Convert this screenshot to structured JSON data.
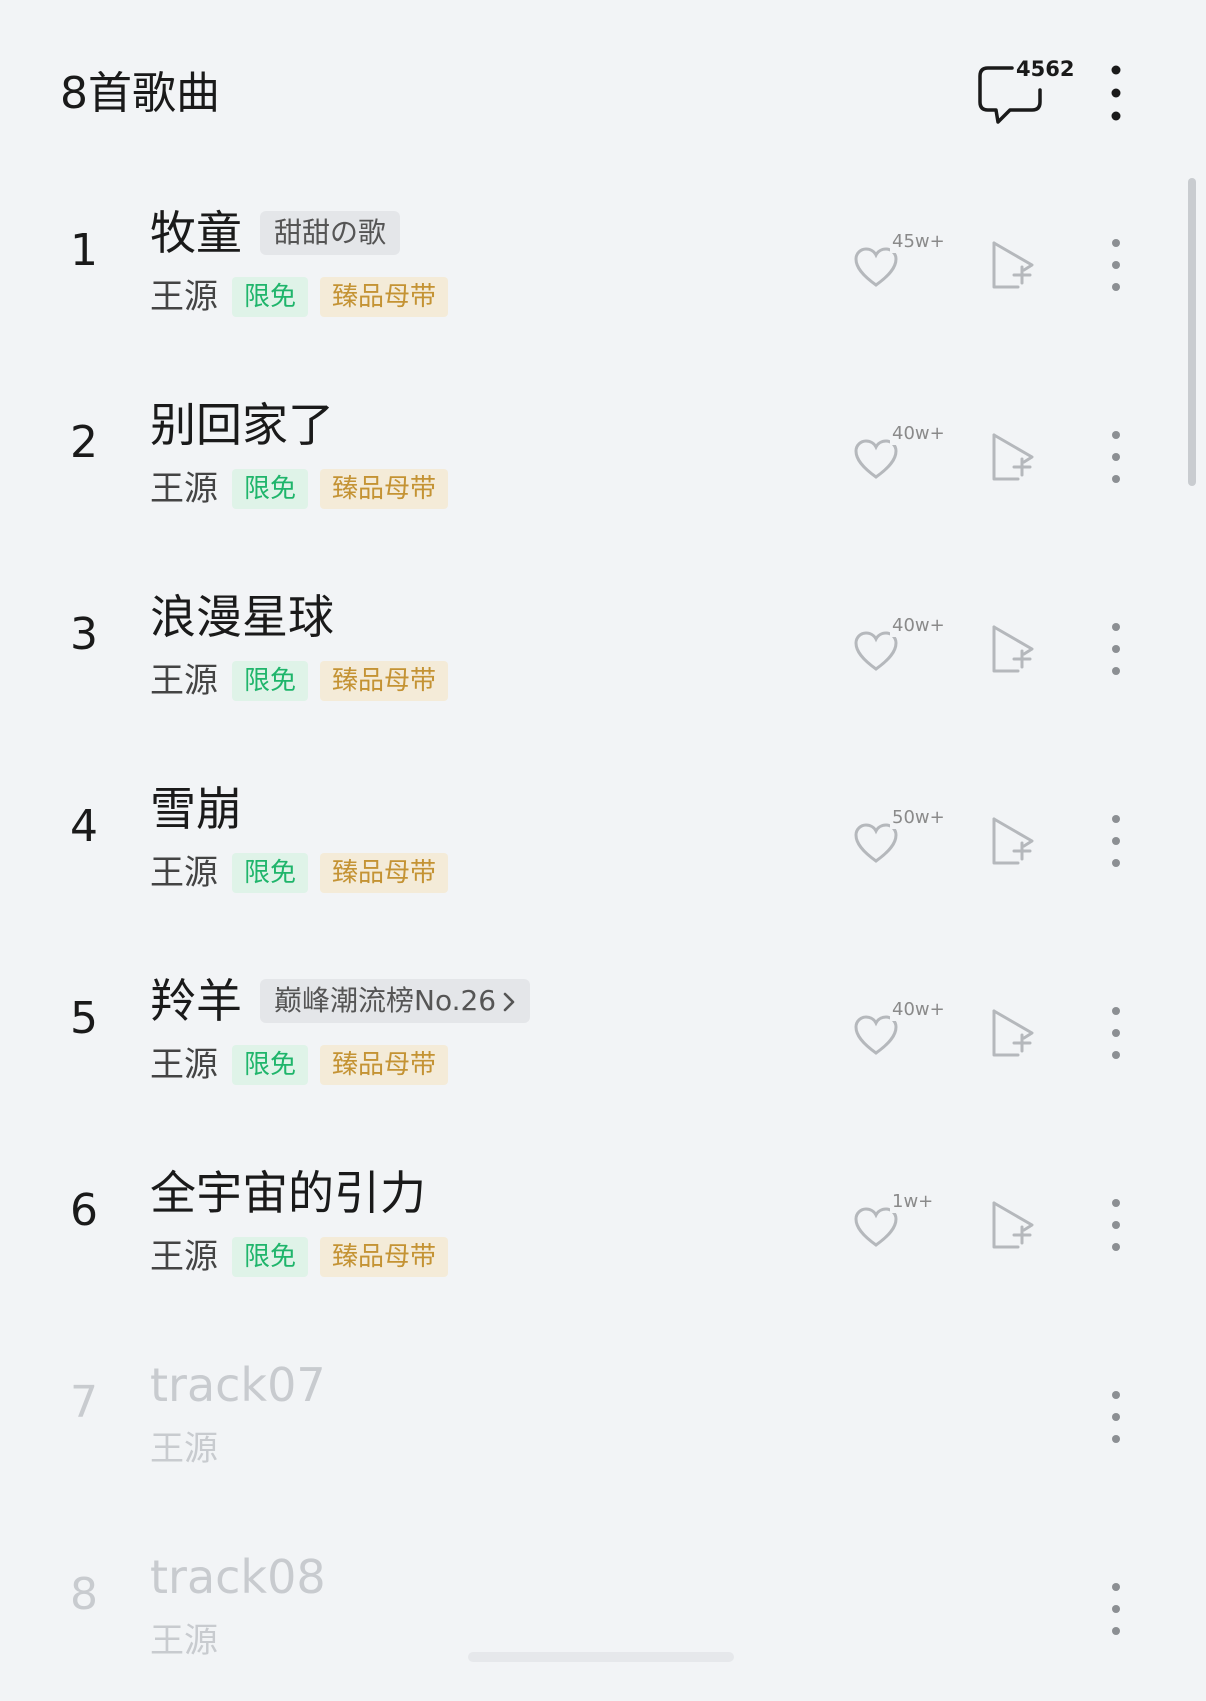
{
  "header": {
    "title": "8首歌曲",
    "comment_count": "4562"
  },
  "songs": [
    {
      "index": "1",
      "title": "牧童",
      "tag": "甜甜の歌",
      "artist": "王源",
      "badge_free": "限免",
      "badge_master": "臻品母带",
      "likes": "45w+"
    },
    {
      "index": "2",
      "title": "别回家了",
      "tag": "",
      "artist": "王源",
      "badge_free": "限免",
      "badge_master": "臻品母带",
      "likes": "40w+"
    },
    {
      "index": "3",
      "title": "浪漫星球",
      "tag": "",
      "artist": "王源",
      "badge_free": "限免",
      "badge_master": "臻品母带",
      "likes": "40w+"
    },
    {
      "index": "4",
      "title": "雪崩",
      "tag": "",
      "artist": "王源",
      "badge_free": "限免",
      "badge_master": "臻品母带",
      "likes": "50w+"
    },
    {
      "index": "5",
      "title": "羚羊",
      "tag": "巅峰潮流榜No.26",
      "artist": "王源",
      "badge_free": "限免",
      "badge_master": "臻品母带",
      "likes": "40w+"
    },
    {
      "index": "6",
      "title": "全宇宙的引力",
      "tag": "",
      "artist": "王源",
      "badge_free": "限免",
      "badge_master": "臻品母带",
      "likes": "1w+"
    },
    {
      "index": "7",
      "title": "track07",
      "tag": "",
      "artist": "王源",
      "badge_free": "",
      "badge_master": "",
      "likes": ""
    },
    {
      "index": "8",
      "title": "track08",
      "tag": "",
      "artist": "王源",
      "badge_free": "",
      "badge_master": "",
      "likes": ""
    }
  ],
  "colors": {
    "background": "#f2f4f6",
    "free_badge_text": "#1fb56b",
    "master_badge_text": "#c49334",
    "unavailable_text": "#c8cbcf"
  },
  "icons": {
    "comment": "speech-bubble-icon",
    "like": "heart-icon",
    "add": "add-to-playlist-icon",
    "more": "more-vertical-icon"
  }
}
